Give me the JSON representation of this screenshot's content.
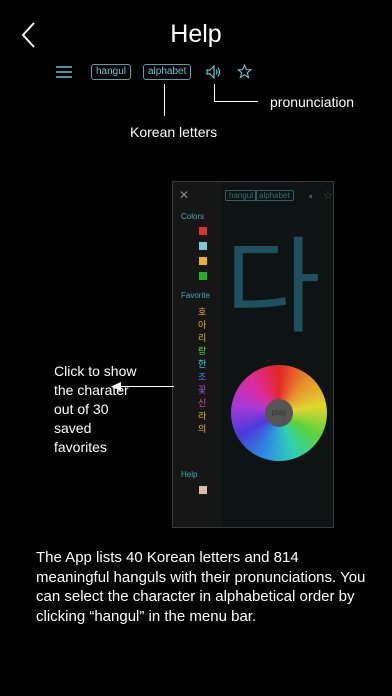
{
  "header": {
    "title": "Help",
    "menu_tags": [
      "hangul",
      "alphabet"
    ]
  },
  "annotations": {
    "pronunciation": "pronunciation",
    "korean_letters": "Korean letters",
    "favorites": "Click to show the charater out of 30 saved favorites"
  },
  "panel": {
    "tags": [
      "hangul",
      "alphabet"
    ],
    "sections": {
      "colors": "Colors",
      "favorite": "Favorite",
      "help": "Help"
    },
    "swatch_colors": [
      "#e23232",
      "#7ec7d6",
      "#e8b224",
      "#21b12a"
    ],
    "favorites": [
      {
        "char": "호",
        "color": "#e3b14a"
      },
      {
        "char": "아",
        "color": "#e3b14a"
      },
      {
        "char": "리",
        "color": "#e3b14a"
      },
      {
        "char": "랑",
        "color": "#6fd14a"
      },
      {
        "char": "한",
        "color": "#47c8e0"
      },
      {
        "char": "조",
        "color": "#4a7ae0"
      },
      {
        "char": "꽃",
        "color": "#a85ae0"
      },
      {
        "char": "신",
        "color": "#e04aa8"
      },
      {
        "char": "라",
        "color": "#e3b14a"
      },
      {
        "char": "의",
        "color": "#e3b14a"
      }
    ],
    "large_char": "다",
    "wheel_label": "play"
  },
  "footer": {
    "description": "The App lists 40 Korean letters and 814 meaningful hanguls with their pronunciations. You can select the character in alphabetical order by clicking “hangul” in the menu bar."
  }
}
